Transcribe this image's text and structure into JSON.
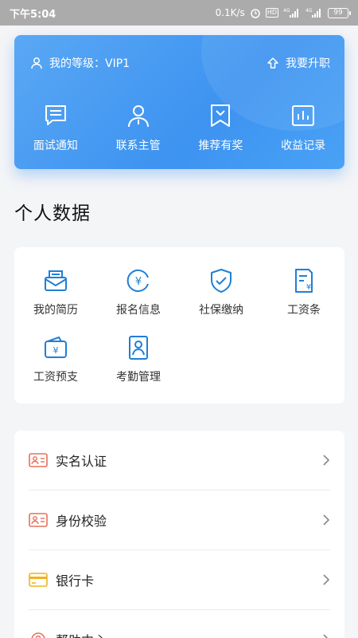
{
  "status_bar": {
    "time": "下午5:04",
    "speed": "0.1K/s",
    "network1": "4G",
    "network2": "4G",
    "battery": "99"
  },
  "vip": {
    "level_text": "我的等级：VIP1",
    "upgrade_label": "我要升职",
    "actions": [
      {
        "label": "面试通知",
        "icon": "message-icon"
      },
      {
        "label": "联系主管",
        "icon": "person-icon"
      },
      {
        "label": "推荐有奖",
        "icon": "bookmark-icon"
      },
      {
        "label": "收益记录",
        "icon": "chart-icon"
      }
    ]
  },
  "personal": {
    "title": "个人数据",
    "items": [
      {
        "label": "我的简历",
        "icon": "resume-icon"
      },
      {
        "label": "报名信息",
        "icon": "yuan-circle-icon"
      },
      {
        "label": "社保缴纳",
        "icon": "shield-icon"
      },
      {
        "label": "工资条",
        "icon": "payslip-icon"
      },
      {
        "label": "工资预支",
        "icon": "wallet-icon"
      },
      {
        "label": "考勤管理",
        "icon": "attendance-icon"
      }
    ]
  },
  "menu": {
    "items": [
      {
        "label": "实名认证",
        "icon": "id-card-icon"
      },
      {
        "label": "身份校验",
        "icon": "id-card-icon"
      },
      {
        "label": "银行卡",
        "icon": "bank-card-icon"
      },
      {
        "label": "帮助中心",
        "icon": "help-icon"
      }
    ]
  },
  "colors": {
    "accent": "#3d93f0",
    "icon_blue": "#1f7fd6",
    "card_orange": "#e8705a",
    "bank_yellow": "#f2b21c"
  }
}
